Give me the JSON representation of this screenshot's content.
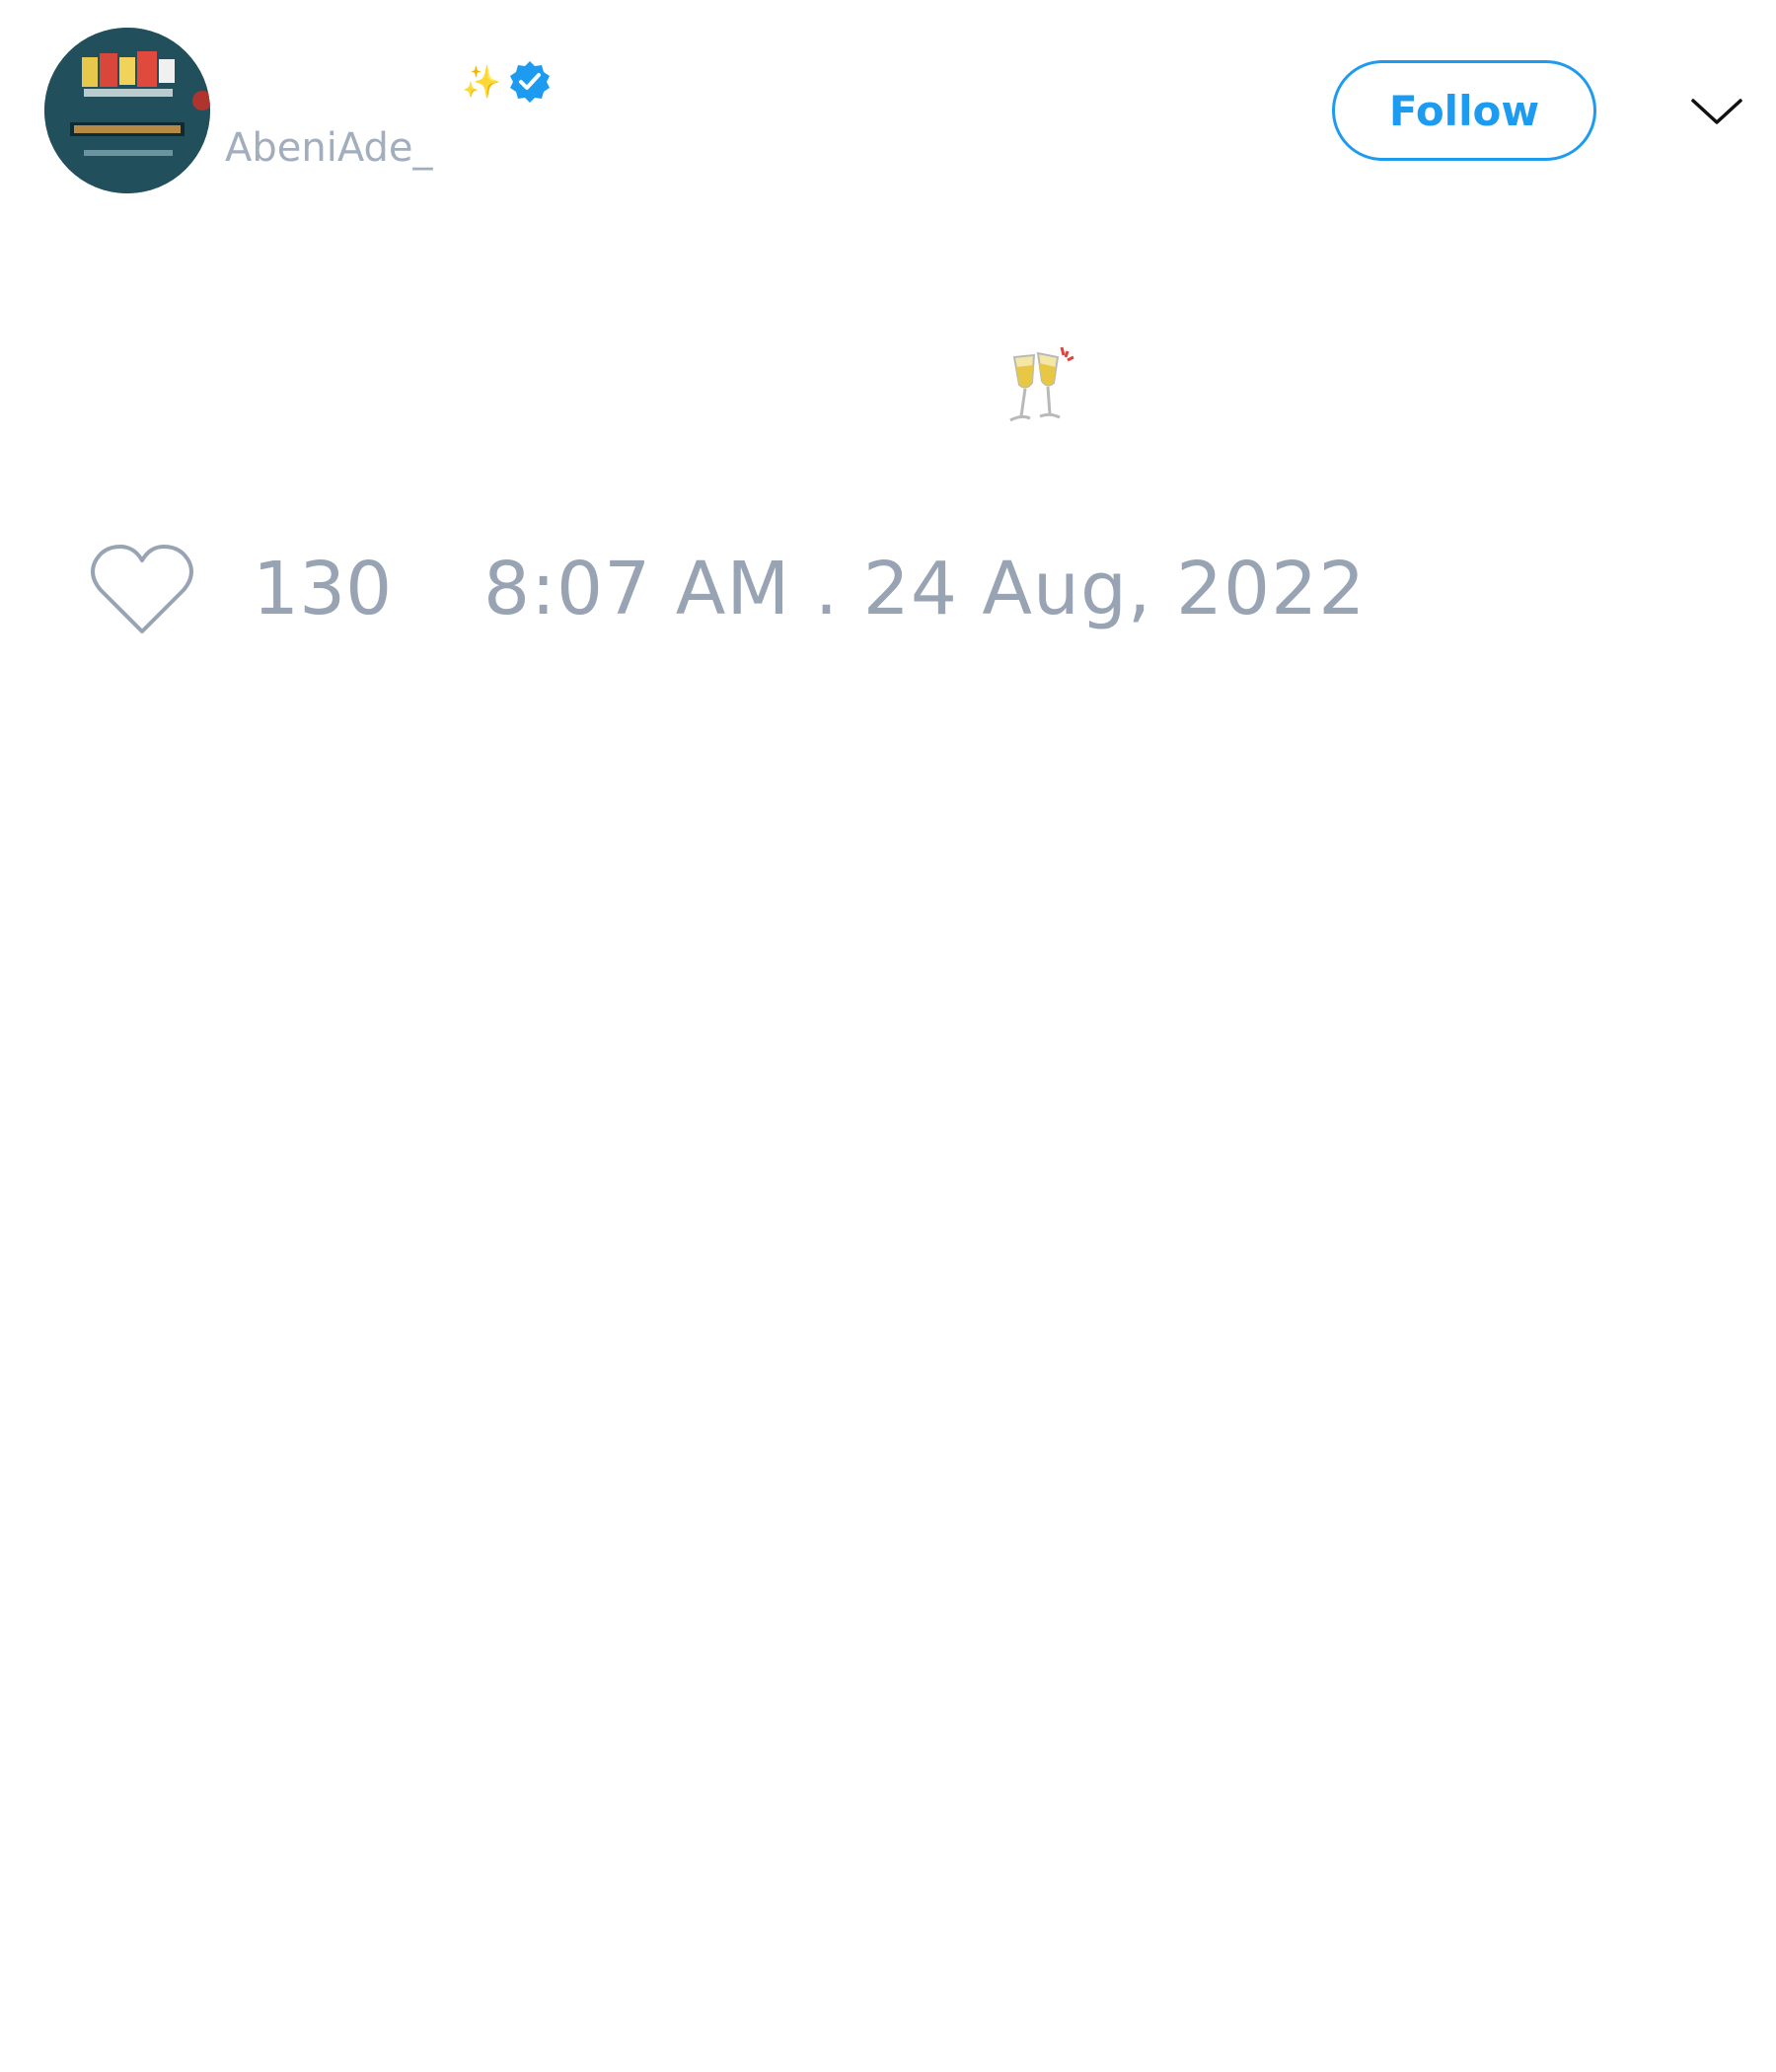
{
  "header": {
    "handle": "AbeniAde_",
    "name_emoji": "✨",
    "follow_label": "Follow"
  },
  "icons": {
    "avatar": "avatar-image",
    "verified": "verified-badge-icon",
    "more": "chevron-down-icon",
    "tweet_emoji": "clinking-glasses-icon",
    "like": "heart-icon"
  },
  "colors": {
    "accent": "#1d9bf0",
    "muted_text": "#98a3b3"
  },
  "tweet": {
    "likes": "130",
    "timestamp": "8:07 AM . 24 Aug, 2022"
  }
}
